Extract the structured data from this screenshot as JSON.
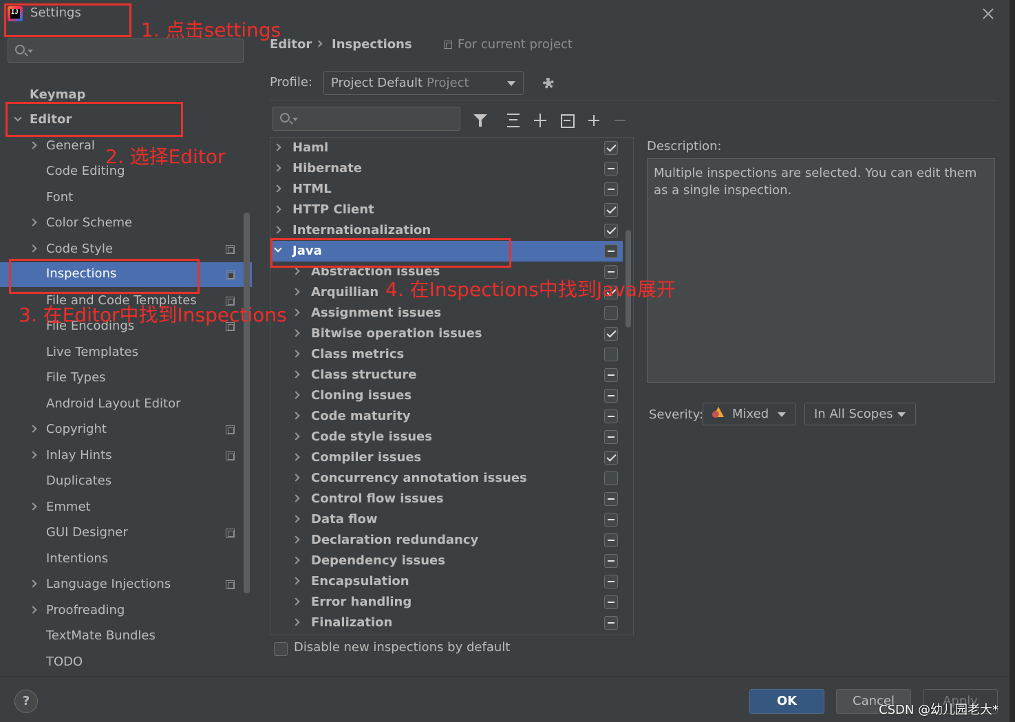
{
  "window": {
    "title": "Settings"
  },
  "sidebar": {
    "search_placeholder": "",
    "items": [
      {
        "label": "Keymap"
      },
      {
        "label": "Editor"
      },
      {
        "label": "General"
      },
      {
        "label": "Code Editing"
      },
      {
        "label": "Font"
      },
      {
        "label": "Color Scheme"
      },
      {
        "label": "Code Style"
      },
      {
        "label": "Inspections",
        "selected": true
      },
      {
        "label": "File and Code Templates"
      },
      {
        "label": "File Encodings"
      },
      {
        "label": "Live Templates"
      },
      {
        "label": "File Types"
      },
      {
        "label": "Android Layout Editor"
      },
      {
        "label": "Copyright"
      },
      {
        "label": "Inlay Hints"
      },
      {
        "label": "Duplicates"
      },
      {
        "label": "Emmet"
      },
      {
        "label": "GUI Designer"
      },
      {
        "label": "Intentions"
      },
      {
        "label": "Language Injections"
      },
      {
        "label": "Proofreading"
      },
      {
        "label": "TextMate Bundles"
      },
      {
        "label": "TODO"
      }
    ]
  },
  "breadcrumb": {
    "editor": "Editor",
    "separator": "›",
    "inspections": "Inspections",
    "scope_note": "For current project"
  },
  "profile": {
    "label": "Profile:",
    "value": "Project Default",
    "scope": "Project"
  },
  "tree": {
    "rows": [
      {
        "label": "Haml",
        "state": "checked"
      },
      {
        "label": "Hibernate",
        "state": "mixed"
      },
      {
        "label": "HTML",
        "state": "mixed"
      },
      {
        "label": "HTTP Client",
        "state": "checked"
      },
      {
        "label": "Internationalization",
        "state": "checked"
      },
      {
        "label": "Java",
        "state": "mixed",
        "expanded": true,
        "selected": true
      },
      {
        "label": "Abstraction issues",
        "state": "mixed"
      },
      {
        "label": "Arquillian",
        "state": "checked"
      },
      {
        "label": "Assignment issues",
        "state": "unchecked"
      },
      {
        "label": "Bitwise operation issues",
        "state": "checked"
      },
      {
        "label": "Class metrics",
        "state": "unchecked"
      },
      {
        "label": "Class structure",
        "state": "mixed"
      },
      {
        "label": "Cloning issues",
        "state": "mixed"
      },
      {
        "label": "Code maturity",
        "state": "mixed"
      },
      {
        "label": "Code style issues",
        "state": "mixed"
      },
      {
        "label": "Compiler issues",
        "state": "checked"
      },
      {
        "label": "Concurrency annotation issues",
        "state": "unchecked"
      },
      {
        "label": "Control flow issues",
        "state": "mixed"
      },
      {
        "label": "Data flow",
        "state": "mixed"
      },
      {
        "label": "Declaration redundancy",
        "state": "mixed"
      },
      {
        "label": "Dependency issues",
        "state": "mixed"
      },
      {
        "label": "Encapsulation",
        "state": "mixed"
      },
      {
        "label": "Error handling",
        "state": "mixed"
      },
      {
        "label": "Finalization",
        "state": "mixed"
      }
    ],
    "disable_new_label": "Disable new inspections by default"
  },
  "description": {
    "label": "Description:",
    "text": "Multiple inspections are selected. You can edit them as a single inspection."
  },
  "severity": {
    "label": "Severity:",
    "value": "Mixed",
    "scope": "In All Scopes"
  },
  "buttons": {
    "help": "?",
    "ok": "OK",
    "cancel": "Cancel",
    "apply": "Apply"
  },
  "watermark": "CSDN @幼儿园老大*",
  "annotations": {
    "step1": "1. 点击settings",
    "step2": "2. 选择Editor",
    "step3": "3. 在Editor中找到Inspections",
    "step4": "4. 在Inspections中找到Java展开"
  },
  "colors": {
    "background": "#3c3f41",
    "selection": "#4b6eaf",
    "annotation": "#e8322b",
    "ok_button": "#365880"
  }
}
